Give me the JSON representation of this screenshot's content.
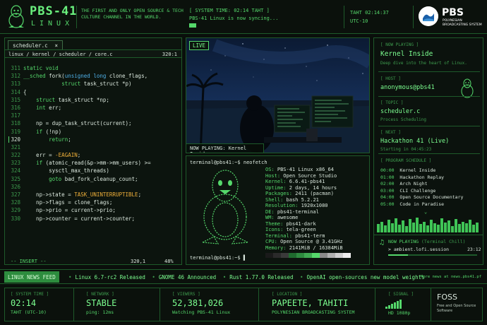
{
  "header": {
    "brand": "PBS-41",
    "brand_sub": "LINUX",
    "tagline": "THE FIRST AND ONLY OPEN SOURCE & TECH CULTURE CHANNEL IN THE WORLD.",
    "system_time_label": "[ SYSTEM TIME: 02:14 TAHT ]",
    "system_message": "PBS-41 Linux is now syncing...",
    "clock": "TAHT 02:14:37",
    "utc": "UTC-10",
    "pbs_name": "PBS",
    "pbs_sub": "POLYNESIAN BROADCASTING SYSTEM"
  },
  "editor": {
    "tab": "scheduler.c",
    "tab_close": "×",
    "path": "linux / kernel / scheduler / core.c",
    "path_num": "320:1",
    "lines": [
      {
        "n": "311",
        "t": "static void"
      },
      {
        "n": "312",
        "t": "__sched fork(unsigned long clone_flags,"
      },
      {
        "n": "313",
        "t": "            struct task_struct *p)"
      },
      {
        "n": "314",
        "t": "{"
      },
      {
        "n": "315",
        "t": "    struct task_struct *np;"
      },
      {
        "n": "316",
        "t": "    int err;"
      },
      {
        "n": "317",
        "t": ""
      },
      {
        "n": "318",
        "t": "    np = dup_task_struct(current);"
      },
      {
        "n": "319",
        "t": "    if (!np)"
      },
      {
        "n": "320",
        "t": "        return;"
      },
      {
        "n": "321",
        "t": ""
      },
      {
        "n": "322",
        "t": "    err = -EAGAIN;"
      },
      {
        "n": "323",
        "t": "    if (atomic_read(&p->mm->mm_users) >="
      },
      {
        "n": "324",
        "t": "        sysctl_max_threads)"
      },
      {
        "n": "325",
        "t": "        goto bad_fork_cleanup_count;"
      },
      {
        "n": "326",
        "t": ""
      },
      {
        "n": "327",
        "t": "    np->state = TASK_UNINTERRUPTIBLE;"
      },
      {
        "n": "328",
        "t": "    np->flags = clone_flags;"
      },
      {
        "n": "329",
        "t": "    np->prio = current->prio;"
      },
      {
        "n": "330",
        "t": "    np->counter = current->counter;"
      }
    ],
    "mode": "-- INSERT --",
    "pos": "320,1",
    "pct": "48%"
  },
  "live": {
    "badge": "LIVE",
    "caption": "NOW PLAYING: Kernel Inside"
  },
  "terminal": {
    "prompt": "terminal@pbs41:~$ neofetch",
    "prompt_bottom": "terminal@pbs41:~$ ▌",
    "neofetch": [
      {
        "k": "OS:",
        "v": "PBS-41 Linux x86_64"
      },
      {
        "k": "Host:",
        "v": "Open Source Studio"
      },
      {
        "k": "Kernel:",
        "v": "6.6.41-pbs41"
      },
      {
        "k": "Uptime:",
        "v": "2 days, 14 hours"
      },
      {
        "k": "Packages:",
        "v": "2411 (pacman)"
      },
      {
        "k": "Shell:",
        "v": "bash 5.2.21"
      },
      {
        "k": "Resolution:",
        "v": "1920x1080"
      },
      {
        "k": "DE:",
        "v": "pbs41-terminal"
      },
      {
        "k": "WM:",
        "v": "awesome"
      },
      {
        "k": "Theme:",
        "v": "pbs41-dark"
      },
      {
        "k": "Icons:",
        "v": "tela-green"
      },
      {
        "k": "Terminal:",
        "v": "pbs41-term"
      },
      {
        "k": "CPU:",
        "v": "Open Source @ 3.41GHz"
      },
      {
        "k": "Memory:",
        "v": "2141MiB / 16384MiB"
      }
    ],
    "swatches": [
      "#1a1a1a",
      "#2a2a2a",
      "#3a3a3a",
      "#1f6b2e",
      "#2e8a3f",
      "#3fa851",
      "#55d86b",
      "#8a8a8a",
      "#b0b0b0",
      "#d0d0d0",
      "#eeeeee"
    ]
  },
  "right": {
    "now_playing_label": "[ NOW PLAYING ]",
    "now_playing": "Kernel Inside",
    "now_playing_desc": "Deep dive into the heart of Linux.",
    "host_label": "[ HOST ]",
    "host": "anonymous@pbs41",
    "topic_label": "[ TOPIC ]",
    "topic": "scheduler.c",
    "topic_desc": "Process Scheduling",
    "next_label": "[ NEXT ]",
    "next": "Hackathon 41 (Live)",
    "next_desc": "Starting in 04:45:23",
    "schedule_label": "[ PROGRAM SCHEDULE ]",
    "schedule": [
      {
        "time": "00:00",
        "title": "Kernel Inside"
      },
      {
        "time": "01:00",
        "title": "Hackathon Replay"
      },
      {
        "time": "02:00",
        "title": "Arch Night"
      },
      {
        "time": "03:00",
        "title": "CLI Challenge"
      },
      {
        "time": "04:00",
        "title": "Open Source Documentary"
      },
      {
        "time": "05:00",
        "title": "Code in Paradise"
      }
    ],
    "schedule_more": "⌄",
    "eq_levels": [
      0.55,
      0.7,
      0.45,
      0.8,
      0.6,
      0.9,
      0.5,
      0.75,
      0.4,
      0.85,
      0.65,
      0.95,
      0.55,
      0.7,
      0.45,
      0.8,
      0.6,
      0.5,
      0.9,
      0.65,
      0.75,
      0.4,
      0.85,
      0.55,
      0.7,
      0.6,
      0.8,
      0.5,
      0.65
    ],
    "np_icon": "♫",
    "np_title": "NOW PLAYING",
    "np_sub": "(Terminal Chill)",
    "np_track": "> ambient.lofi.session",
    "np_time": "23:12",
    "np_progress": 0.22
  },
  "ticker": {
    "label": "LINUX NEWS FEED",
    "items": [
      "Linux 6.7-rc2 Released",
      "GNOME 46 Announced",
      "Rust 1.77.0 Released",
      "OpenAI open-sources new model weights"
    ],
    "more": "More news at news.pbs41.pf"
  },
  "footer": {
    "systime_label": "[ SYSTEM TIME ]",
    "systime": "02:14",
    "systime_sub": "TAHT (UTC-10)",
    "network_label": "[ NETWORK ]",
    "network": "STABLE",
    "network_sub": "ping: 12ms",
    "viewers_label": "[ VIEWERS ]",
    "viewers": "52,381,026",
    "viewers_sub": "Watching PBS-41 Linux",
    "location_label": "[ LOCATION ]",
    "location": "PAPEETE, TAHITI",
    "location_sub": "POLYNESIAN BROADCASTING SYSTEM",
    "signal_label": "[ SIGNAL ]",
    "signal_sub": "HD 1080p",
    "foss": "FOSS",
    "foss_sub": "Free and Open Source Software"
  },
  "colors": {
    "accent": "#55d86b",
    "bright": "#7cff90",
    "background": "#0a0f0b",
    "border": "#1e5a2a",
    "highlight": "#f0b03a"
  }
}
